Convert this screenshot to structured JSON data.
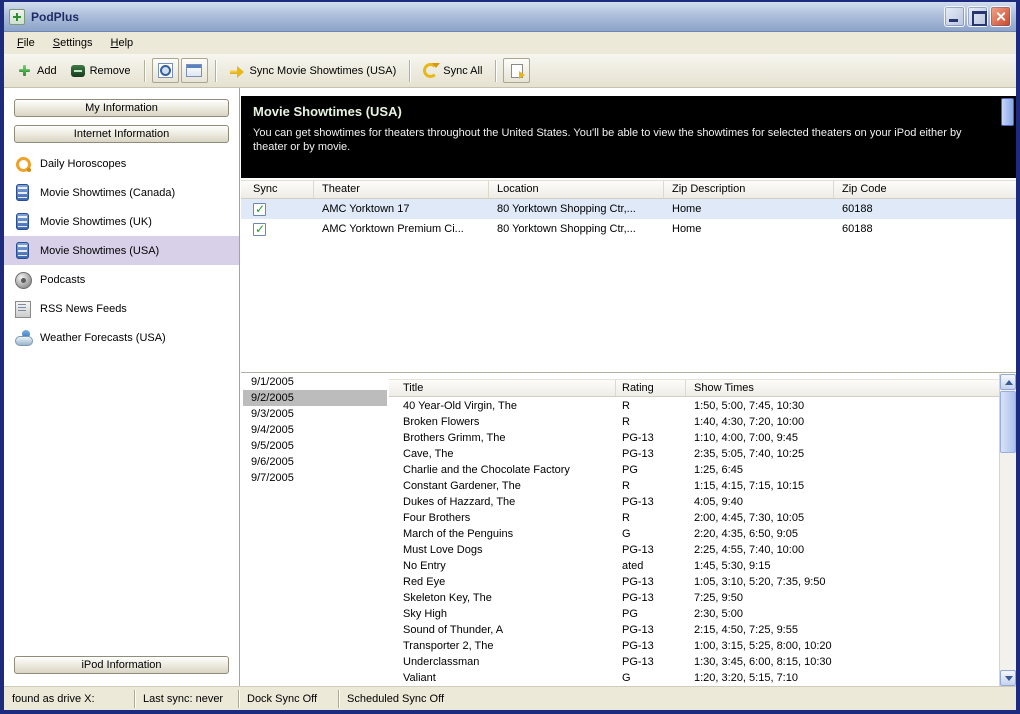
{
  "window": {
    "title": "PodPlus"
  },
  "menubar": {
    "items": [
      "File",
      "Settings",
      "Help"
    ]
  },
  "toolbar": {
    "add": "Add",
    "remove": "Remove",
    "sync_selected": "Sync Movie Showtimes (USA)",
    "sync_all": "Sync All"
  },
  "sidebar": {
    "my_information": "My Information",
    "internet_information": "Internet Information",
    "ipod_information": "iPod Information",
    "items": [
      {
        "label": "Daily Horoscopes",
        "icon": "horoscope",
        "selected": false
      },
      {
        "label": "Movie Showtimes (Canada)",
        "icon": "movie",
        "selected": false
      },
      {
        "label": "Movie Showtimes (UK)",
        "icon": "movie",
        "selected": false
      },
      {
        "label": "Movie Showtimes (USA)",
        "icon": "movie",
        "selected": true
      },
      {
        "label": "Podcasts",
        "icon": "podcast",
        "selected": false
      },
      {
        "label": "RSS News Feeds",
        "icon": "rss",
        "selected": false
      },
      {
        "label": "Weather Forecasts (USA)",
        "icon": "weather",
        "selected": false
      }
    ]
  },
  "main_header": {
    "title": "Movie Showtimes (USA)",
    "description": "You can get showtimes for theaters throughout the United States. You'll be able to view the showtimes for selected theaters on your iPod either by theater or by movie."
  },
  "theaters": {
    "columns": [
      "Sync",
      "Theater",
      "Location",
      "Zip Description",
      "Zip Code"
    ],
    "rows": [
      {
        "sync": true,
        "theater": "AMC Yorktown 17",
        "location": "80 Yorktown Shopping Ctr,...",
        "zip_description": "Home",
        "zip_code": "60188",
        "selected": true
      },
      {
        "sync": true,
        "theater": "AMC Yorktown Premium Ci...",
        "location": "80 Yorktown Shopping Ctr,...",
        "zip_description": "Home",
        "zip_code": "60188",
        "selected": false
      }
    ]
  },
  "showtimes": {
    "columns": [
      "Title",
      "Rating",
      "Show Times"
    ],
    "dates": [
      "9/1/2005",
      "9/2/2005",
      "9/3/2005",
      "9/4/2005",
      "9/5/2005",
      "9/6/2005",
      "9/7/2005"
    ],
    "selected_date": "9/2/2005",
    "movies": [
      {
        "title": "40 Year-Old Virgin, The",
        "rating": "R",
        "times": "1:50, 5:00, 7:45, 10:30"
      },
      {
        "title": "Broken Flowers",
        "rating": "R",
        "times": "1:40, 4:30, 7:20, 10:00"
      },
      {
        "title": "Brothers Grimm, The",
        "rating": "PG-13",
        "times": "1:10, 4:00, 7:00, 9:45"
      },
      {
        "title": "Cave, The",
        "rating": "PG-13",
        "times": "2:35, 5:05, 7:40, 10:25"
      },
      {
        "title": "Charlie and the Chocolate Factory",
        "rating": "PG",
        "times": "1:25, 6:45"
      },
      {
        "title": "Constant Gardener, The",
        "rating": "R",
        "times": "1:15, 4:15, 7:15, 10:15"
      },
      {
        "title": "Dukes of Hazzard, The",
        "rating": "PG-13",
        "times": "4:05, 9:40"
      },
      {
        "title": "Four Brothers",
        "rating": "R",
        "times": "2:00, 4:45, 7:30, 10:05"
      },
      {
        "title": "March of the Penguins",
        "rating": "G",
        "times": "2:20, 4:35, 6:50, 9:05"
      },
      {
        "title": "Must Love Dogs",
        "rating": "PG-13",
        "times": "2:25, 4:55, 7:40, 10:00"
      },
      {
        "title": "No Entry",
        "rating": "ated",
        "times": "1:45, 5:30, 9:15"
      },
      {
        "title": "Red Eye",
        "rating": "PG-13",
        "times": "1:05, 3:10, 5:20, 7:35, 9:50"
      },
      {
        "title": "Skeleton Key, The",
        "rating": "PG-13",
        "times": "7:25, 9:50"
      },
      {
        "title": "Sky High",
        "rating": "PG",
        "times": "2:30, 5:00"
      },
      {
        "title": "Sound of Thunder, A",
        "rating": "PG-13",
        "times": "2:15, 4:50, 7:25, 9:55"
      },
      {
        "title": "Transporter 2, The",
        "rating": "PG-13",
        "times": "1:00, 3:15, 5:25, 8:00, 10:20"
      },
      {
        "title": "Underclassman",
        "rating": "PG-13",
        "times": "1:30, 3:45, 6:00, 8:15, 10:30"
      },
      {
        "title": "Valiant",
        "rating": "G",
        "times": "1:20, 3:20, 5:15, 7:10"
      }
    ]
  },
  "statusbar": {
    "items": [
      "found as drive X:",
      "Last sync: never",
      "Dock Sync Off",
      "Scheduled Sync Off"
    ]
  },
  "icons": {
    "app-icon": "green-plus-tile",
    "add-icon": "green-plus",
    "remove-icon": "dark-green-minus",
    "magnifier-icon": "magnifier-over-page",
    "card-icon": "info-card",
    "sync-icon": "yellow-arrow",
    "sync-all-icon": "yellow-circular-arrows",
    "sync-doc-icon": "document-with-sync-arrow",
    "checkbox-check": "✓",
    "horoscope-icon": "orange-ring",
    "movie-icon": "blue-filmstrip",
    "podcast-icon": "gray-speaker-circle",
    "rss-icon": "newspaper",
    "weather-icon": "cloud-sun"
  },
  "colors": {
    "sidebar_selection": "#d8d0e8",
    "row_selection": "#dfe9f8",
    "date_selection": "#bcbcbc",
    "header_bg": "#000000",
    "header_title": "#e6f3e0",
    "window_border": "#1c2b7e"
  }
}
